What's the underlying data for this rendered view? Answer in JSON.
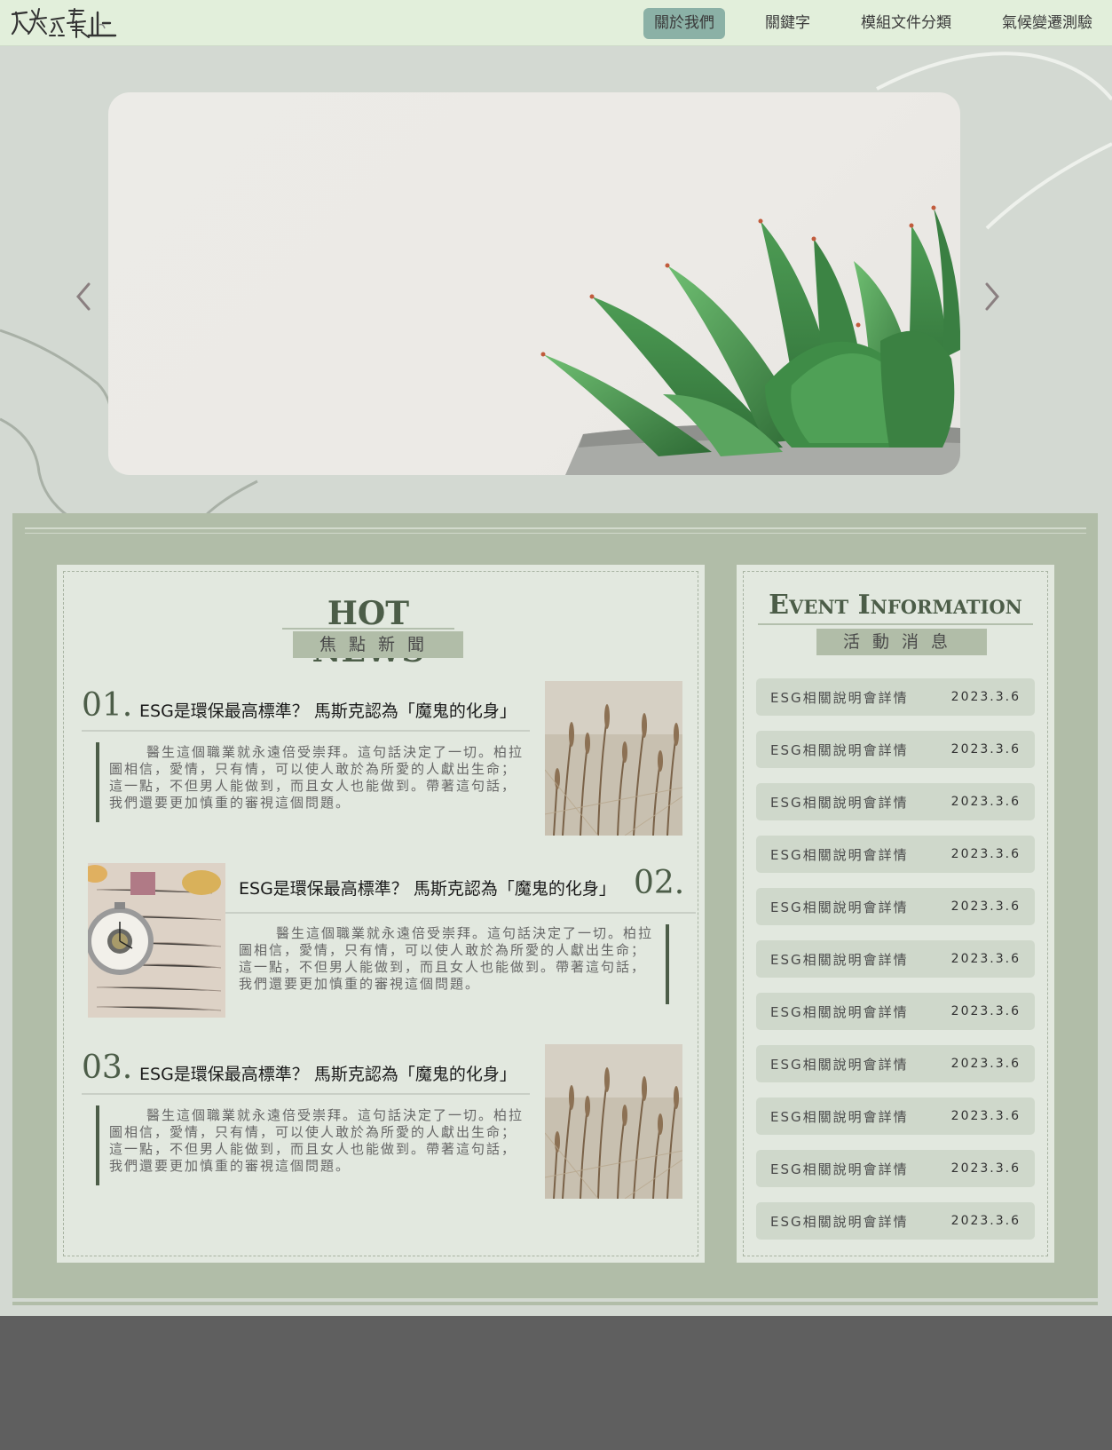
{
  "header": {
    "logo_text": "碳為觀止",
    "nav": [
      {
        "label": "關於我們",
        "active": true
      },
      {
        "label": "關鍵字",
        "active": false
      },
      {
        "label": "模組文件分類",
        "active": false
      },
      {
        "label": "氣候變遷測驗",
        "active": false
      }
    ]
  },
  "hero": {
    "prev_icon": "chevron-left-icon",
    "next_icon": "chevron-right-icon"
  },
  "hot_news": {
    "title": "HOT NEWS",
    "subtitle": "焦點新聞",
    "items": [
      {
        "num": "01.",
        "title": "ESG是環保最高標準？ 馬斯克認為「魔鬼的化身」",
        "body": "醫生這個職業就永遠倍受崇拜。這句話決定了一切。柏拉圖相信，愛情，只有情，可以使人敢於為所愛的人獻出生命；這一點，不但男人能做到，而且女人也能做到。帶著這句話，我們還要更加慎重的審視這個問題。",
        "image": "wheat-grass"
      },
      {
        "num": "02.",
        "title": "ESG是環保最高標準？ 馬斯克認為「魔鬼的化身」",
        "body": "醫生這個職業就永遠倍受崇拜。這句話決定了一切。柏拉圖相信，愛情，只有情，可以使人敢於為所愛的人獻出生命；這一點，不但男人能做到，而且女人也能做到。帶著這句話，我們還要更加慎重的審視這個問題。",
        "image": "pocket-watch-letter"
      },
      {
        "num": "03.",
        "title": "ESG是環保最高標準？ 馬斯克認為「魔鬼的化身」",
        "body": "醫生這個職業就永遠倍受崇拜。這句話決定了一切。柏拉圖相信，愛情，只有情，可以使人敢於為所愛的人獻出生命；這一點，不但男人能做到，而且女人也能做到。帶著這句話，我們還要更加慎重的審視這個問題。",
        "image": "wheat-grass"
      }
    ]
  },
  "events": {
    "title": "Event Information",
    "subtitle": "活動消息",
    "items": [
      {
        "name": "ESG相關說明會詳情",
        "date": "2023.3.6"
      },
      {
        "name": "ESG相關說明會詳情",
        "date": "2023.3.6"
      },
      {
        "name": "ESG相關說明會詳情",
        "date": "2023.3.6"
      },
      {
        "name": "ESG相關說明會詳情",
        "date": "2023.3.6"
      },
      {
        "name": "ESG相關說明會詳情",
        "date": "2023.3.6"
      },
      {
        "name": "ESG相關說明會詳情",
        "date": "2023.3.6"
      },
      {
        "name": "ESG相關說明會詳情",
        "date": "2023.3.6"
      },
      {
        "name": "ESG相關說明會詳情",
        "date": "2023.3.6"
      },
      {
        "name": "ESG相關說明會詳情",
        "date": "2023.3.6"
      },
      {
        "name": "ESG相關說明會詳情",
        "date": "2023.3.6"
      },
      {
        "name": "ESG相關說明會詳情",
        "date": "2023.3.6"
      }
    ]
  },
  "colors": {
    "header_bg": "#e2efdb",
    "nav_active": "#8bb1a6",
    "accent_green": "#4c5d48",
    "panel": "#b1bda8",
    "footer": "#5f5f5f"
  }
}
